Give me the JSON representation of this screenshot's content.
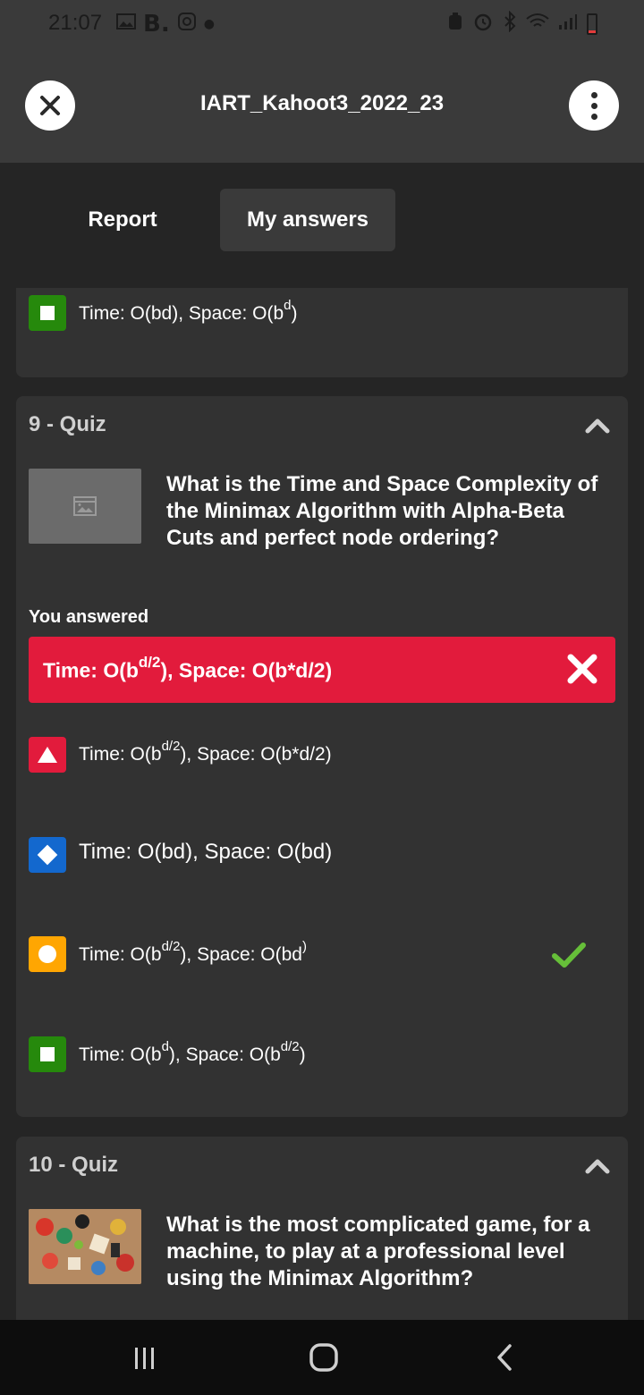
{
  "status_bar": {
    "time": "21:07",
    "left_icons": [
      "gallery-icon",
      "B.",
      "instagram-icon",
      "dot-icon"
    ],
    "right_icons": [
      "nfc-icon",
      "alarm-icon",
      "bluetooth-icon",
      "wifi-icon",
      "signal-icon",
      "battery-low-icon"
    ]
  },
  "header": {
    "title": "IART_Kahoot3_2022_23"
  },
  "tabs": [
    {
      "label": "Report",
      "selected": false
    },
    {
      "label": "My answers",
      "selected": true
    }
  ],
  "prev_card": {
    "option": {
      "color": "green",
      "shape": "square",
      "base": "Time: O(bd), Space: O(b",
      "sup": "d",
      "after": ")"
    }
  },
  "quiz9": {
    "header": "9 - Quiz",
    "question": "What is the Time and Space Complexity of the Minimax Algorithm with Alpha-Beta Cuts and perfect node ordering?",
    "you_answered_label": "You answered",
    "answer": {
      "base": "Time: O(b",
      "sup": "d/2",
      "after": "), Space: O(b*d/2)",
      "correct": false
    },
    "options": [
      {
        "color": "red",
        "shape": "triangle",
        "base": "Time: O(b",
        "sup": "d/2",
        "after": "), Space: O(b*d/2)",
        "correct": false
      },
      {
        "color": "blue",
        "shape": "diamond",
        "base": "Time: O(bd), Space: O(bd)",
        "sup": "",
        "after": "",
        "correct": false
      },
      {
        "color": "yellow",
        "shape": "circle",
        "base": "Time: O(b",
        "sup": "d/2",
        "after": "), Space: O(bd",
        "sup2": ")",
        "correct": true
      },
      {
        "color": "green",
        "shape": "square",
        "base": "Time: O(b",
        "sup": "d",
        "after": "), Space: O(b",
        "sup2": "d/2",
        "after2": ")",
        "correct": false
      }
    ]
  },
  "quiz10": {
    "header": "10 - Quiz",
    "question": "What is the most complicated game, for a machine, to play at a professional level using the Minimax Algorithm?"
  },
  "colors": {
    "red": "#e21b3c",
    "blue": "#1368ce",
    "yellow": "#ffa602",
    "green": "#26890c",
    "correct_check": "#66bf39"
  }
}
